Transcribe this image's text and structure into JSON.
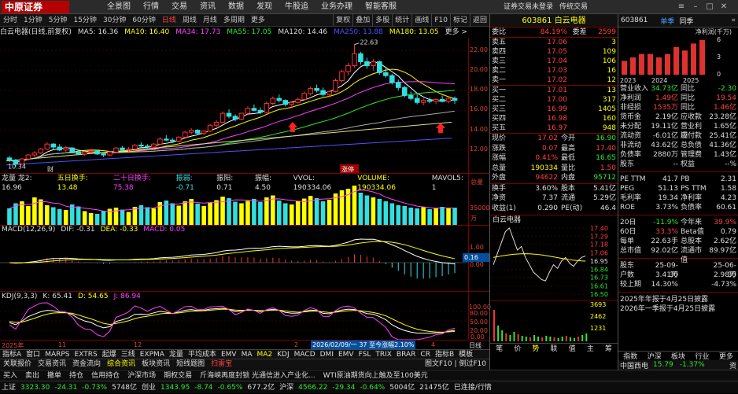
{
  "brand": {
    "name": "中原证券",
    "sub": "CENTRAL CHINA SECURITIES"
  },
  "menu": [
    "全景图",
    "行情",
    "交易",
    "资讯",
    "数据",
    "发现",
    "牛股追",
    "业务办理",
    "智能客服"
  ],
  "top_right": [
    "证券交易未登录",
    "传统交易"
  ],
  "periods": [
    "分时",
    "1分钟",
    "5分钟",
    "15分钟",
    "30分钟",
    "60分钟",
    "日线",
    "周线",
    "月线",
    "多周期",
    "更多"
  ],
  "period_active": "日线",
  "period_buttons": [
    "复权",
    "叠加",
    "多股",
    "统计",
    "画线",
    "F10",
    "标记",
    "返回"
  ],
  "info": {
    "name": "白云电器(日线,前复权)",
    "ma5": "MA5: 16.36",
    "ma10": "MA10: 16.40",
    "ma34": "MA34: 17.73",
    "ma55": "MA55: 17.05",
    "ma120": "MA120: 14.46",
    "ma250": "MA250: 13.88",
    "ma180": "MA180: 13.05",
    "more": "更多 >"
  },
  "k_annot": {
    "high": "22.63",
    "low": "10.34",
    "tag_cai": "财",
    "tag_zhang": "涨停"
  },
  "k_axis": [
    "22.00",
    "20.00",
    "18.00",
    "16.00",
    "14.00",
    "12.00"
  ],
  "vol_info": {
    "title": "龙量 龙2: 16.96",
    "a": "五日换手: 13.48",
    "b": "二十日换手: 75.38",
    "c": "振弱: -0.71",
    "d": "振阳: 0.71",
    "e": "振幅: 4.50",
    "f": "VVOL: 190334.06",
    "g": "VOLUME: 190334.06",
    "h": "MAVOL5: 1"
  },
  "v_axis": [
    "总量",
    "35000",
    "万"
  ],
  "macd_info": {
    "title": "MACD(12,26,9)",
    "dif": "DIF: -0.31",
    "dea": "DEA: -0.33",
    "macd": "MACD: 0.05"
  },
  "m_axis": [
    "0.16",
    "1.00",
    "0.00"
  ],
  "m_marker": "0.16",
  "kdj_info": {
    "title": "KDJ(9,3,3)",
    "k": "K: 65.41",
    "d": "D: 54.65",
    "j": "J: 86.94"
  },
  "kd_axis": [
    "100.00",
    "80.00",
    "50.00",
    "20.00",
    "0.00"
  ],
  "date_axis": {
    "y2025": "2025年",
    "m11": "11",
    "m12": "12",
    "m2": "2",
    "m3": "3",
    "m4": "4",
    "highlight": "2026/02/09/一 37 至今涨幅2.10%",
    "end": "日线"
  },
  "indicator_tabs": [
    "指标A",
    "窗口",
    "MARPS",
    "EXTRS",
    "起爆",
    "三线",
    "EXPMA",
    "龙量",
    "平均成本",
    "EMV",
    "MA",
    "MA2",
    "KDJ",
    "MACD",
    "DMI",
    "EMV",
    "FSL",
    "TRIX",
    "BRAR",
    "CR",
    "指标B",
    "模板"
  ],
  "bottom_tabs": [
    "关联报价",
    "交易资讯",
    "资金流向",
    "综合资讯",
    "板块资讯",
    "短线题图",
    "扫雷宝"
  ],
  "bottom_tabs_right": "图文F10 | 倒过F10",
  "news": [
    "买入",
    "卖出",
    "撤单",
    "持仓",
    "信用持仓",
    "沪深市场",
    "期权交易",
    "斤海峡再度封锁 光通信进入产业化...",
    "WTI原油期货向上触及至100美元"
  ],
  "status": {
    "sh_label": "上证",
    "sh_val": "3323.30",
    "sh_chg": "-24.31",
    "sh_pct": "-0.73%",
    "sh_amt": "5748亿",
    "sz_label": "创业",
    "sz_val": "1343.95",
    "sz_chg": "-8.74",
    "sz_pct": "-0.65%",
    "sz_amt": "677.2亿",
    "hs_label": "沪深",
    "hs_val": "4566.22",
    "hs_chg": "-29.34",
    "hs_pct": "-0.64%",
    "hs_amt": "5004亿",
    "total": "21475亿",
    "extra": "已连接/行情"
  },
  "quote": {
    "code": "603861",
    "name": "白云电器",
    "wb": {
      "label": "委比",
      "val": "84.19%",
      "label2": "委差",
      "val2": "2599"
    },
    "sells": [
      {
        "l": "卖五",
        "p": "17.06",
        "v": "3"
      },
      {
        "l": "卖四",
        "p": "17.05",
        "v": "109"
      },
      {
        "l": "卖三",
        "p": "17.04",
        "v": "106"
      },
      {
        "l": "卖二",
        "p": "17.03",
        "v": "16"
      },
      {
        "l": "卖一",
        "p": "17.02",
        "v": "12"
      }
    ],
    "buys": [
      {
        "l": "买一",
        "p": "17.01",
        "v": "13"
      },
      {
        "l": "买二",
        "p": "17.00",
        "v": "317"
      },
      {
        "l": "买三",
        "p": "16.99",
        "v": "1405"
      },
      {
        "l": "买四",
        "p": "16.98",
        "v": "160"
      },
      {
        "l": "买五",
        "p": "16.97",
        "v": "948"
      }
    ],
    "stats": [
      {
        "l": "现价",
        "v": "17.02",
        "l2": "今开",
        "v2": "16.90",
        "c1": "red",
        "c2": "grn"
      },
      {
        "l": "涨跌",
        "v": "0.07",
        "l2": "最高",
        "v2": "17.40",
        "c1": "red",
        "c2": "red"
      },
      {
        "l": "涨幅",
        "v": "0.41%",
        "l2": "最低",
        "v2": "16.65",
        "c1": "red",
        "c2": "grn"
      },
      {
        "l": "总量",
        "v": "190334",
        "l2": "量比",
        "v2": "1.50",
        "c1": "yel",
        "c2": "red"
      },
      {
        "l": "外盘",
        "v": "94622",
        "l2": "内盘",
        "v2": "95712",
        "c1": "red",
        "c2": "grn"
      }
    ],
    "stats2": [
      {
        "l": "换手",
        "v": "3.60%",
        "l2": "股本",
        "v2": "5.41亿"
      },
      {
        "l": "净资",
        "v": "7.37",
        "l2": "流通",
        "v2": "5.29亿"
      },
      {
        "l": "收益(1)",
        "v": "0.290",
        "l2": "PE(动)",
        "v2": "46.4"
      }
    ],
    "mini_name": "白云电器",
    "mini_axis": [
      "17.40",
      "17.29",
      "17.18",
      "17.06",
      "16.95",
      "16.84",
      "16.73",
      "16.61",
      "16.50"
    ],
    "mini_vol": [
      "3693",
      "2462",
      "1231"
    ],
    "mini_tabs": [
      "笔",
      "价",
      "势",
      "联",
      "值",
      "主",
      "筹"
    ],
    "mini_active": "势"
  },
  "fin": {
    "code": "603861",
    "tab1": "单季",
    "tab2": "同季",
    "hdr": "净利润(千万)",
    "bars": {
      "years": [
        "2023",
        "2024",
        "2025"
      ],
      "values": [
        4,
        5,
        6,
        6,
        5,
        6,
        8,
        7,
        9,
        10
      ]
    },
    "y_axis": [
      "6",
      "3",
      "0"
    ],
    "rows": [
      {
        "l": "营业收入",
        "v": "34.73亿",
        "l2": "同比",
        "v2": "-2.30",
        "c": "grn"
      },
      {
        "l": "净利润",
        "v": "1.49亿",
        "l2": "同比",
        "v2": "19.54",
        "c": "red"
      },
      {
        "l": "非经损",
        "v": "1535万",
        "l2": "同比",
        "v2": "1.46亿",
        "c": "red"
      },
      {
        "l": "货币金",
        "v": "2.19亿",
        "l2": "应收款",
        "v2": "23.28亿",
        "c": "wht"
      },
      {
        "l": "未分配",
        "v": "19.11亿",
        "l2": "营业利润",
        "v2": "1.65亿",
        "c": "wht"
      },
      {
        "l": "流动资",
        "v": "-6.01亿",
        "l2": "应付款",
        "v2": "25.41亿",
        "c": "wht"
      },
      {
        "l": "非流动",
        "v": "43.62亿",
        "l2": "总负债",
        "v2": "41.36亿",
        "c": "wht"
      },
      {
        "l": "负债率",
        "v": "2880万",
        "l2": "管理费",
        "v2": "1.43亿",
        "c": "wht"
      },
      {
        "l": "股东",
        "v": "--",
        "l2": "权益",
        "v2": "--%",
        "c": "wht"
      }
    ],
    "pe": [
      {
        "l": "PE TTM",
        "v": "41.7",
        "l2": "PB",
        "v2": "2.31"
      },
      {
        "l": "PEG",
        "v": "51.13",
        "l2": "PS TTM",
        "v2": "1.58"
      },
      {
        "l": "毛利率",
        "v": "19.34",
        "l2": "净利率",
        "v2": "4.23"
      },
      {
        "l": "ROE",
        "v": "3.73%",
        "l2": "负债率",
        "v2": "60.61"
      }
    ],
    "days": [
      {
        "l": "20日",
        "v": "-11.9%",
        "l2": "今年来",
        "v2": "39.9%",
        "c": "grn",
        "c2": "red"
      },
      {
        "l": "60日",
        "v": "33.3%",
        "l2": "Beta值",
        "v2": "0.79",
        "c": "red",
        "c2": "wht"
      },
      {
        "l": "每单",
        "v": "22.63手",
        "l2": "总股本",
        "v2": "2.62亿",
        "c": "wht",
        "c2": "wht"
      },
      {
        "l": "总市值",
        "v": "92.02亿",
        "l2": "流通市值",
        "v2": "89.97亿",
        "c": "wht",
        "c2": "wht"
      }
    ],
    "holders": [
      {
        "l": "股东",
        "v": "25-09-30",
        "l2": "",
        "v2": "25-06-30"
      },
      {
        "l": "户数",
        "v": "3.41万",
        "l2": "",
        "v2": "2.98万"
      },
      {
        "l": "较上期",
        "v": "14.30%",
        "l2": "",
        "v2": "-4.73%"
      }
    ],
    "notes": [
      "2025年年报于4月25日披露",
      "2026年一季报于4月25日披露"
    ],
    "tabs": [
      "指数",
      "沪深",
      "板块",
      "行业",
      "更多"
    ],
    "ticker": {
      "name": "中国西电",
      "price": "15.79",
      "pct": "-1.37%",
      "tab": "资"
    }
  },
  "chart_data": [
    {
      "type": "candlestick",
      "title": "白云电器(日线,前复权)",
      "ylim": [
        10,
        23
      ],
      "ohlc": [
        [
          11.2,
          11.4,
          10.8,
          11.0
        ],
        [
          11.0,
          11.1,
          10.34,
          10.6
        ],
        [
          10.6,
          11.2,
          10.5,
          11.1
        ],
        [
          11.1,
          11.6,
          11.0,
          11.5
        ],
        [
          11.5,
          11.9,
          11.3,
          11.7
        ],
        [
          11.7,
          12.2,
          11.6,
          12.1
        ],
        [
          12.1,
          12.8,
          12.0,
          12.6
        ],
        [
          12.6,
          12.7,
          12.1,
          12.3
        ],
        [
          12.3,
          12.6,
          11.9,
          12.0
        ],
        [
          12.0,
          12.4,
          11.8,
          12.2
        ],
        [
          12.2,
          12.3,
          11.7,
          11.8
        ],
        [
          11.8,
          12.0,
          11.5,
          11.6
        ],
        [
          11.6,
          11.9,
          11.4,
          11.8
        ],
        [
          11.8,
          12.1,
          11.6,
          11.9
        ],
        [
          11.9,
          12.0,
          11.5,
          11.6
        ],
        [
          11.6,
          11.8,
          11.3,
          11.5
        ],
        [
          11.5,
          11.9,
          11.4,
          11.8
        ],
        [
          11.8,
          12.3,
          11.7,
          12.2
        ],
        [
          12.2,
          12.4,
          11.9,
          12.0
        ],
        [
          12.0,
          12.3,
          11.8,
          12.1
        ],
        [
          12.1,
          12.6,
          12.0,
          12.5
        ],
        [
          12.5,
          12.8,
          12.3,
          12.4
        ],
        [
          12.4,
          12.6,
          12.1,
          12.3
        ],
        [
          12.3,
          12.7,
          12.2,
          12.6
        ],
        [
          12.6,
          13.3,
          12.5,
          13.1
        ],
        [
          13.1,
          13.5,
          12.9,
          13.0
        ],
        [
          13.0,
          13.2,
          12.7,
          12.9
        ],
        [
          12.9,
          13.4,
          12.8,
          13.3
        ],
        [
          13.3,
          13.9,
          13.2,
          13.8
        ],
        [
          13.8,
          14.2,
          13.6,
          14.0
        ],
        [
          14.0,
          14.1,
          13.5,
          13.7
        ],
        [
          13.7,
          14.0,
          13.5,
          13.9
        ],
        [
          13.9,
          14.6,
          13.8,
          14.5
        ],
        [
          14.5,
          15.0,
          14.3,
          14.8
        ],
        [
          14.8,
          15.9,
          14.7,
          15.7
        ],
        [
          15.7,
          16.1,
          15.2,
          15.4
        ],
        [
          15.4,
          15.6,
          14.9,
          15.1
        ],
        [
          15.1,
          15.8,
          15.0,
          15.7
        ],
        [
          15.7,
          16.4,
          15.6,
          16.2
        ],
        [
          16.2,
          16.6,
          15.9,
          16.0
        ],
        [
          16.0,
          16.3,
          15.6,
          15.8
        ],
        [
          15.8,
          16.9,
          15.7,
          16.7
        ],
        [
          16.7,
          17.4,
          16.5,
          17.2
        ],
        [
          17.2,
          17.6,
          16.8,
          17.0
        ],
        [
          17.0,
          17.1,
          16.4,
          16.6
        ],
        [
          16.6,
          16.9,
          16.3,
          16.8
        ],
        [
          16.8,
          17.3,
          16.7,
          17.1
        ],
        [
          17.1,
          17.9,
          17.0,
          17.7
        ],
        [
          17.7,
          18.4,
          17.5,
          18.2
        ],
        [
          18.2,
          18.6,
          17.8,
          18.0
        ],
        [
          18.0,
          18.3,
          17.4,
          17.6
        ],
        [
          17.6,
          18.0,
          17.3,
          17.9
        ],
        [
          17.9,
          19.2,
          17.8,
          19.0
        ],
        [
          19.0,
          20.1,
          18.8,
          19.9
        ],
        [
          19.9,
          20.8,
          19.5,
          20.5
        ],
        [
          20.5,
          22.63,
          20.3,
          21.7
        ],
        [
          21.7,
          21.9,
          20.6,
          20.9
        ],
        [
          20.9,
          21.3,
          20.2,
          20.5
        ],
        [
          20.5,
          21.2,
          20.0,
          20.9
        ],
        [
          20.9,
          21.0,
          19.6,
          19.8
        ],
        [
          19.8,
          20.4,
          19.3,
          19.5
        ],
        [
          19.5,
          19.7,
          18.6,
          18.8
        ],
        [
          18.8,
          19.1,
          18.0,
          18.3
        ],
        [
          18.3,
          18.5,
          17.3,
          17.5
        ],
        [
          17.5,
          17.9,
          17.0,
          17.2
        ],
        [
          17.2,
          17.6,
          16.6,
          16.8
        ],
        [
          16.8,
          17.2,
          16.5,
          17.0
        ],
        [
          17.0,
          17.3,
          16.7,
          16.9
        ],
        [
          16.9,
          17.2,
          16.6,
          17.1
        ],
        [
          17.1,
          17.5,
          16.8,
          16.9
        ],
        [
          16.9,
          17.3,
          16.7,
          17.2
        ],
        [
          17.2,
          17.4,
          16.65,
          17.02
        ]
      ]
    },
    {
      "type": "bar",
      "title": "龙量",
      "values": [
        42,
        55,
        60,
        48,
        70,
        65,
        50,
        45,
        40,
        38,
        52,
        47,
        35,
        30,
        28,
        36,
        41,
        44,
        39,
        33,
        46,
        50,
        45,
        42,
        58,
        62,
        55,
        49,
        60,
        66,
        54,
        48,
        57,
        63,
        72,
        68,
        59,
        55,
        61,
        66,
        58,
        70,
        75,
        62,
        55,
        52,
        60,
        67,
        74,
        68,
        60,
        64,
        80,
        88,
        92,
        100,
        82,
        75,
        70,
        66,
        60,
        55,
        50,
        48,
        44,
        42,
        45,
        40,
        43,
        46,
        42,
        44
      ]
    },
    {
      "type": "line",
      "title": "MACD(12,26,9)",
      "series": [
        {
          "name": "DIF",
          "values": [
            -0.31
          ]
        },
        {
          "name": "DEA",
          "values": [
            -0.33
          ]
        },
        {
          "name": "MACD",
          "values": [
            0.05
          ]
        }
      ]
    },
    {
      "type": "line",
      "title": "KDJ(9,3,3)",
      "series": [
        {
          "name": "K",
          "values": [
            65.41
          ]
        },
        {
          "name": "D",
          "values": [
            54.65
          ]
        },
        {
          "name": "J",
          "values": [
            86.94
          ]
        }
      ]
    }
  ]
}
